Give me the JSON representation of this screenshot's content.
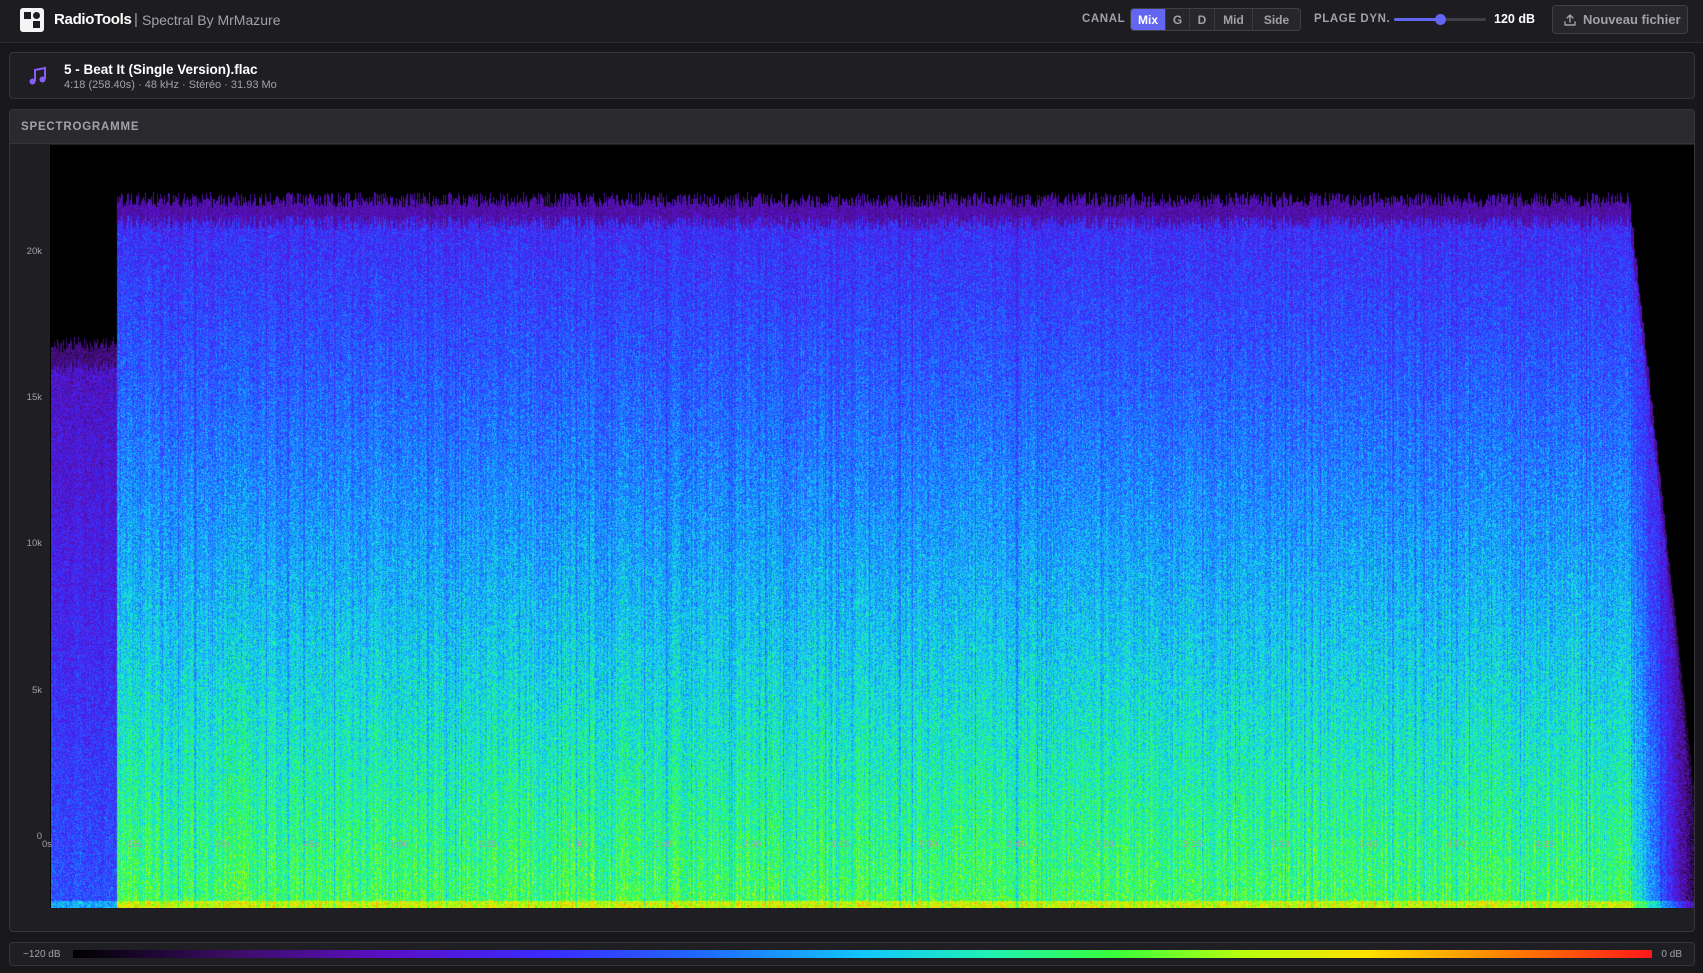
{
  "header": {
    "brand": "RadioTools",
    "separator": "|",
    "subtitle": "Spectral By MrMazure",
    "canal_label": "CANAL",
    "channels": [
      "Mix",
      "G",
      "D",
      "Mid",
      "Side"
    ],
    "selected_channel": "Mix",
    "dyn_label": "PLAGE DYN.",
    "dyn_value": "120 dB",
    "dyn_fraction": 0.5,
    "new_file_label": "Nouveau fichier"
  },
  "file": {
    "name": "5 - Beat It (Single Version).flac",
    "meta": "4:18 (258.40s) · 48 kHz · Stéréo · 31.93 Mo"
  },
  "spectrogram": {
    "title": "SPECTROGRAMME",
    "y_ticks": [
      "20k",
      "15k",
      "10k",
      "5k",
      "0"
    ],
    "x_ticks": [
      "0s",
      "15s",
      "30s",
      "45s",
      "1:00",
      "1:15",
      "1:30",
      "1:45",
      "2:00",
      "2:15",
      "2:30",
      "2:45",
      "3:00",
      "3:15",
      "3:30",
      "3:45",
      "4:00",
      "4:15"
    ]
  },
  "colorbar": {
    "min_label": "−120 dB",
    "max_label": "0 dB"
  },
  "colors": {
    "accent": "#6366f1",
    "background": "#18181b",
    "panel": "#1f1f23"
  },
  "icons": {
    "logo": "radiotools-logo-icon",
    "file": "music-note-icon",
    "upload": "upload-icon"
  }
}
